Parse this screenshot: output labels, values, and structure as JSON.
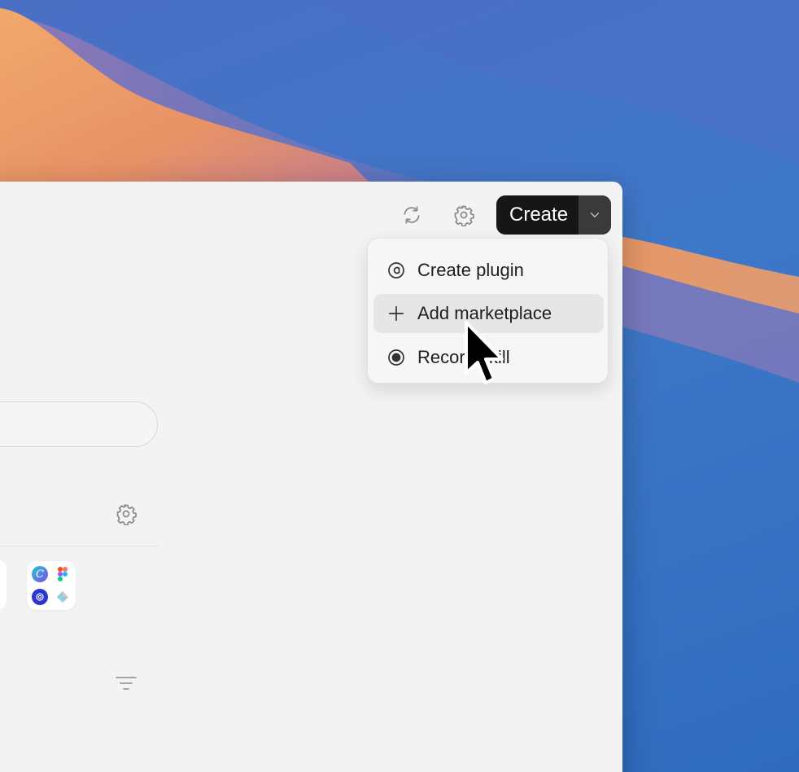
{
  "toolbar": {
    "refresh_icon": "refresh-icon",
    "settings_icon": "gear-icon",
    "create_label": "Create",
    "create_caret_icon": "chevron-down-icon"
  },
  "create_menu": {
    "items": [
      {
        "label": "Create plugin",
        "icon": "plugin-icon"
      },
      {
        "label": "Add marketplace",
        "icon": "plus-icon"
      },
      {
        "label": "Record skill",
        "icon": "record-icon"
      }
    ]
  },
  "sidebar": {
    "settings_icon": "gear-icon",
    "filter_icon": "filter-icon"
  },
  "apps": {
    "icons": [
      "canva-icon",
      "figma-icon",
      "openai-icon",
      "gem-icon"
    ],
    "canva_letter": "C"
  },
  "colors": {
    "create_button": "#161616",
    "menu_highlight": "#e6e6e6",
    "window_bg": "#f3f3f3"
  }
}
